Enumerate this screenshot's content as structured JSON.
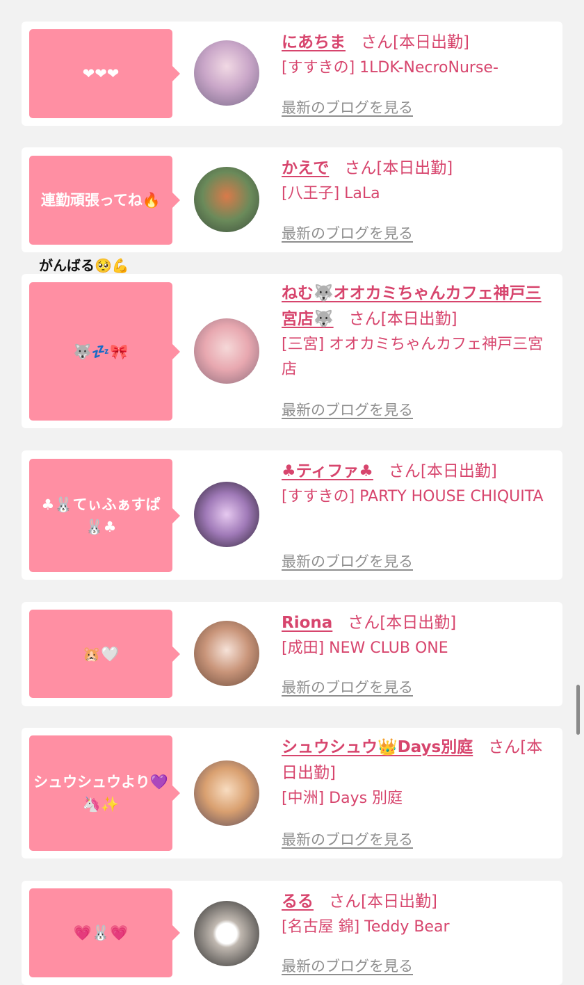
{
  "entries": [
    {
      "message": "❤❤❤",
      "name": "にあちま",
      "status": "さん[本日出勤]",
      "shop": "[すすきの] 1LDK-NecroNurse-",
      "blog": "最新のブログを見る"
    },
    {
      "message": "連勤頑張ってね🔥",
      "name": "かえで",
      "status": "さん[本日出勤]",
      "shop": "[八王子] LaLa",
      "blog": "最新のブログを見る",
      "reply": "がんばる🥺💪"
    },
    {
      "message": "🐺💤🎀",
      "name": "ねむ🐺オオカミちゃんカフェ神戸三宮店🐺",
      "status": "さん[本日出勤]",
      "shop": "[三宮] オオカミちゃんカフェ神戸三宮店",
      "blog": "最新のブログを見る"
    },
    {
      "message": "♣🐰てぃふぁすぱ🐰♣",
      "name": "♣ティファ♣",
      "status": "さん[本日出勤]",
      "shop": "[すすきの] PARTY HOUSE CHIQUITA",
      "blog": "最新のブログを見る"
    },
    {
      "message": "🐹🤍",
      "name": "Riona",
      "status": "さん[本日出勤]",
      "shop": "[成田] NEW CLUB ONE",
      "blog": "最新のブログを見る"
    },
    {
      "message": "シュウシュウより💜🦄✨",
      "name": "シュウシュウ👑Days別庭",
      "status": "さん[本日出勤]",
      "shop": "[中洲] Days 別庭",
      "blog": "最新のブログを見る"
    },
    {
      "message": "💗🐰💗",
      "name": "るる",
      "status": "さん[本日出勤]",
      "shop": "[名古屋 錦] Teddy Bear",
      "blog": "最新のブログを見る"
    }
  ]
}
